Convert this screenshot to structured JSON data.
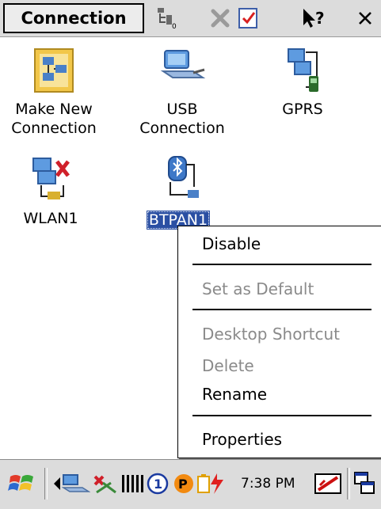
{
  "header": {
    "title": "Connection",
    "tools": [
      {
        "name": "view-icon",
        "label": ""
      },
      {
        "name": "delete-icon",
        "label": ""
      },
      {
        "name": "check-icon",
        "label": ""
      },
      {
        "name": "help-icon",
        "label": "?"
      },
      {
        "name": "close-icon",
        "label": "×"
      }
    ]
  },
  "connections": [
    {
      "label": "Make New\nConnection",
      "icon": "make-new-connection-icon",
      "selected": false
    },
    {
      "label": "USB\nConnection",
      "icon": "usb-connection-icon",
      "selected": false
    },
    {
      "label": "GPRS",
      "icon": "gprs-connection-icon",
      "selected": false
    },
    {
      "label": "WLAN1",
      "icon": "wlan-connection-icon",
      "selected": false
    },
    {
      "label": "BTPAN1",
      "icon": "btpan-connection-icon",
      "selected": true
    }
  ],
  "context_menu": {
    "items": [
      {
        "label": "Disable",
        "enabled": true
      },
      {
        "label": "Set as Default",
        "enabled": false
      },
      {
        "label": "Desktop Shortcut",
        "enabled": false
      },
      {
        "label": "Delete",
        "enabled": false
      },
      {
        "label": "Rename",
        "enabled": true
      },
      {
        "label": "Properties",
        "enabled": true
      }
    ]
  },
  "taskbar": {
    "time": "7:38 PM",
    "icons": [
      "start-icon",
      "back-arrow-icon",
      "network-icon",
      "bluetooth-icon",
      "battery-icon",
      "numlock-icon",
      "alpha-icon",
      "power-icon",
      "keyboard-icon",
      "windows-icon"
    ]
  },
  "colors": {
    "selection": "#2a4fa3",
    "bar": "#dcdcdc",
    "disabled_text": "#8a8a8a"
  }
}
